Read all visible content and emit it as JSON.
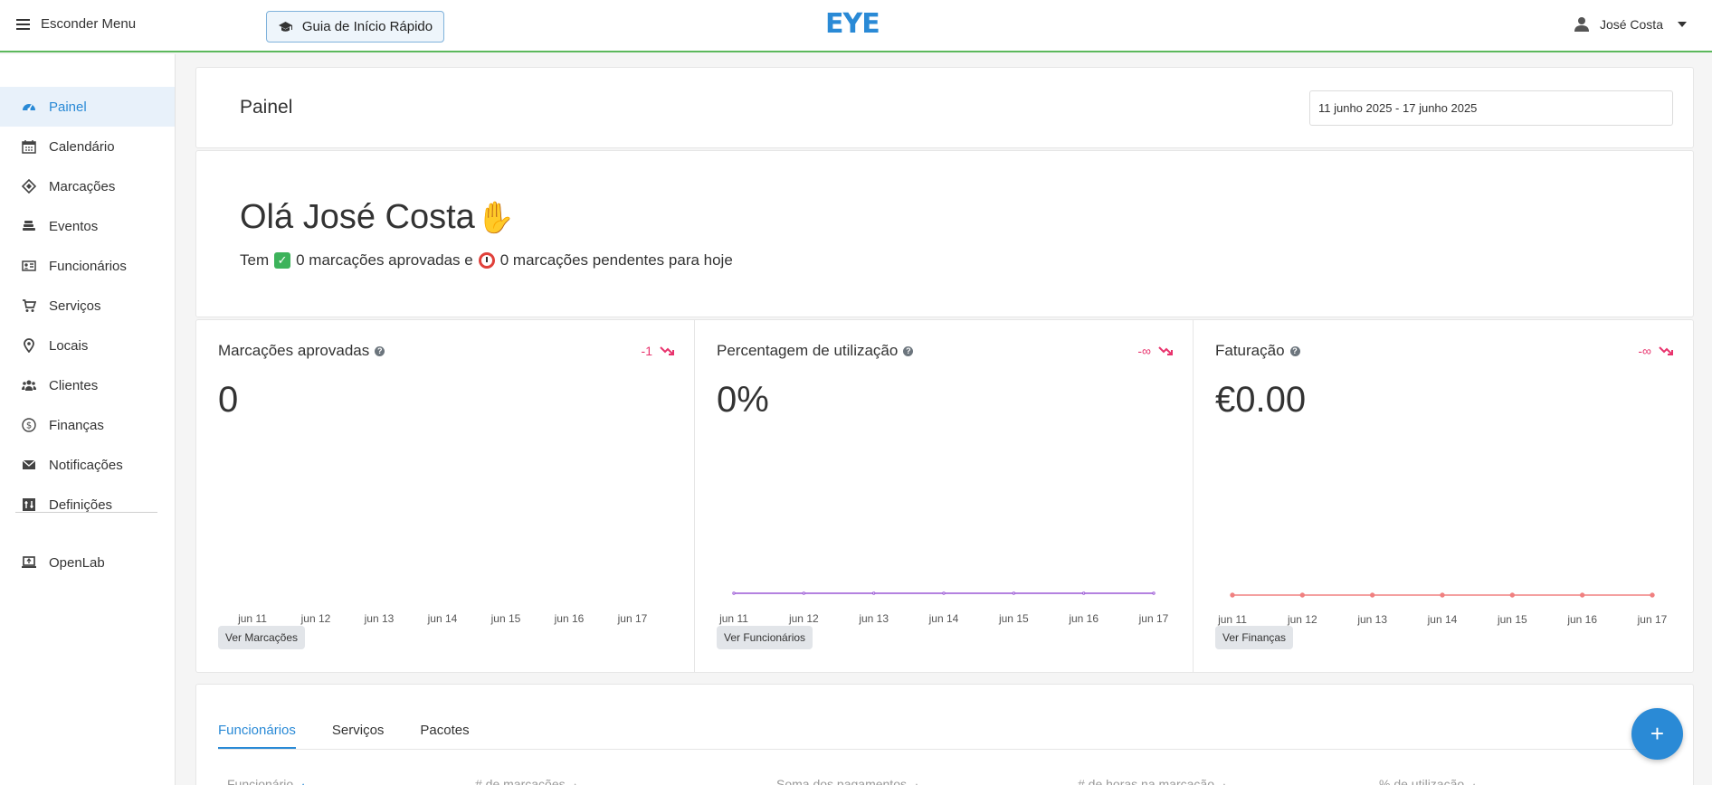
{
  "topbar": {
    "menu_toggle": "Esconder Menu",
    "quickstart": "Guia de Início Rápido",
    "logo": "EYE",
    "user_name": "José Costa"
  },
  "sidebar": {
    "items": [
      {
        "label": "Painel",
        "icon": "dashboard-icon",
        "active": true
      },
      {
        "label": "Calendário",
        "icon": "calendar-icon"
      },
      {
        "label": "Marcações",
        "icon": "ticket-icon"
      },
      {
        "label": "Eventos",
        "icon": "events-icon"
      },
      {
        "label": "Funcionários",
        "icon": "id-card-icon"
      },
      {
        "label": "Serviços",
        "icon": "cart-icon"
      },
      {
        "label": "Locais",
        "icon": "location-pin-icon"
      },
      {
        "label": "Clientes",
        "icon": "users-icon"
      },
      {
        "label": "Finanças",
        "icon": "dollar-icon"
      },
      {
        "label": "Notificações",
        "icon": "envelope-icon"
      },
      {
        "label": "Definições",
        "icon": "settings-icon"
      },
      {
        "label": "OpenLab",
        "icon": "laptop-icon"
      }
    ]
  },
  "header": {
    "title": "Painel",
    "date_range": "11 junho 2025 - 17 junho 2025"
  },
  "welcome": {
    "greeting": "Olá José Costa",
    "summary_prefix": "Tem",
    "summary_approved": "0 marcações aprovadas e",
    "summary_pending": "0 marcações pendentes para hoje"
  },
  "stats": [
    {
      "title": "Marcações aprovadas",
      "delta": "-1",
      "value": "0",
      "button": "Ver Marcações"
    },
    {
      "title": "Percentagem de utilização",
      "delta": "-∞",
      "value": "0%",
      "button": "Ver Funcionários"
    },
    {
      "title": "Faturação",
      "delta": "-∞",
      "value": "€0.00",
      "button": "Ver Finanças"
    }
  ],
  "chart_data": [
    {
      "type": "bar",
      "categories": [
        "jun 11",
        "jun 12",
        "jun 13",
        "jun 14",
        "jun 15",
        "jun 16",
        "jun 17"
      ],
      "values": [
        0,
        0,
        0,
        0,
        0,
        0,
        0
      ],
      "color": "#2a8ad6"
    },
    {
      "type": "line",
      "categories": [
        "jun 11",
        "jun 12",
        "jun 13",
        "jun 14",
        "jun 15",
        "jun 16",
        "jun 17"
      ],
      "values": [
        0,
        0,
        0,
        0,
        0,
        0,
        0
      ],
      "color": "#9b59d6"
    },
    {
      "type": "line",
      "categories": [
        "jun 11",
        "jun 12",
        "jun 13",
        "jun 14",
        "jun 15",
        "jun 16",
        "jun 17"
      ],
      "values": [
        0,
        0,
        0,
        0,
        0,
        0,
        0
      ],
      "color": "#f08080"
    }
  ],
  "tabs": {
    "items": [
      "Funcionários",
      "Serviços",
      "Pacotes"
    ],
    "active": "Funcionários"
  },
  "table": {
    "headers": [
      "Funcionário",
      "# de marcações",
      "Soma dos pagamentos",
      "# de horas na marcação",
      "% de utilização"
    ]
  },
  "fab": {
    "label": "+"
  },
  "colors": {
    "accent": "#2a8ad6",
    "negative": "#e8336d",
    "success_line": "#5cb85c"
  }
}
